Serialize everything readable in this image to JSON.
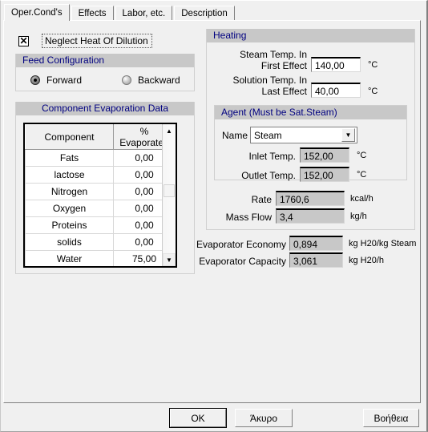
{
  "tabs": [
    {
      "label": "Oper.Cond's",
      "active": true
    },
    {
      "label": "Effects",
      "active": false
    },
    {
      "label": "Labor, etc.",
      "active": false
    },
    {
      "label": "Description",
      "active": false
    }
  ],
  "checkbox": {
    "label": "Neglect Heat Of Dilution",
    "checked": true,
    "mark": "✕"
  },
  "feed_configuration": {
    "title": "Feed Configuration",
    "options": [
      {
        "label": "Forward",
        "selected": true
      },
      {
        "label": "Backward",
        "selected": false
      }
    ]
  },
  "component_table": {
    "title": "Component Evaporation Data",
    "columns": [
      "Component",
      "% Evaporated"
    ],
    "rows": [
      {
        "component": "Fats",
        "evaporated": "0,00"
      },
      {
        "component": "lactose",
        "evaporated": "0,00"
      },
      {
        "component": "Nitrogen",
        "evaporated": "0,00"
      },
      {
        "component": "Oxygen",
        "evaporated": "0,00"
      },
      {
        "component": "Proteins",
        "evaporated": "0,00"
      },
      {
        "component": "solids",
        "evaporated": "0,00"
      },
      {
        "component": "Water",
        "evaporated": "75,00"
      }
    ],
    "scroll_up_icon": "▲",
    "scroll_down_icon": "▼"
  },
  "heating": {
    "title": "Heating",
    "steam_temp": {
      "label_line1": "Steam Temp. In",
      "label_line2": "First Effect",
      "value": "140,00",
      "unit": "°C"
    },
    "solution_temp": {
      "label_line1": "Solution Temp. In",
      "label_line2": "Last Effect",
      "value": "40,00",
      "unit": "°C"
    },
    "agent": {
      "title": "Agent (Must be Sat.Steam)",
      "name_label": "Name",
      "name_value": "Steam",
      "dropdown_icon": "▼",
      "inlet_temp": {
        "label": "Inlet Temp.",
        "value": "152,00",
        "unit": "°C"
      },
      "outlet_temp": {
        "label": "Outlet Temp.",
        "value": "152,00",
        "unit": "°C"
      }
    },
    "rate": {
      "label": "Rate",
      "value": "1760,6",
      "unit": "kcal/h"
    },
    "mass_flow": {
      "label": "Mass Flow",
      "value": "3,4",
      "unit": "kg/h"
    }
  },
  "evaporator": {
    "economy": {
      "label": "Evaporator Economy",
      "value": "0,894",
      "unit": "kg H20/kg Steam"
    },
    "capacity": {
      "label": "Evaporator Capacity",
      "value": "3,061",
      "unit": "kg H20/h"
    }
  },
  "buttons": {
    "ok": "OK",
    "cancel": "Άκυρο",
    "help": "Βοήθεια"
  },
  "colors": {
    "group_title_text": "#000080",
    "group_title_bg": "#c8c8c8",
    "dialog_bg": "#f0f0f0",
    "readonly_field_bg": "#c8c8c8"
  }
}
